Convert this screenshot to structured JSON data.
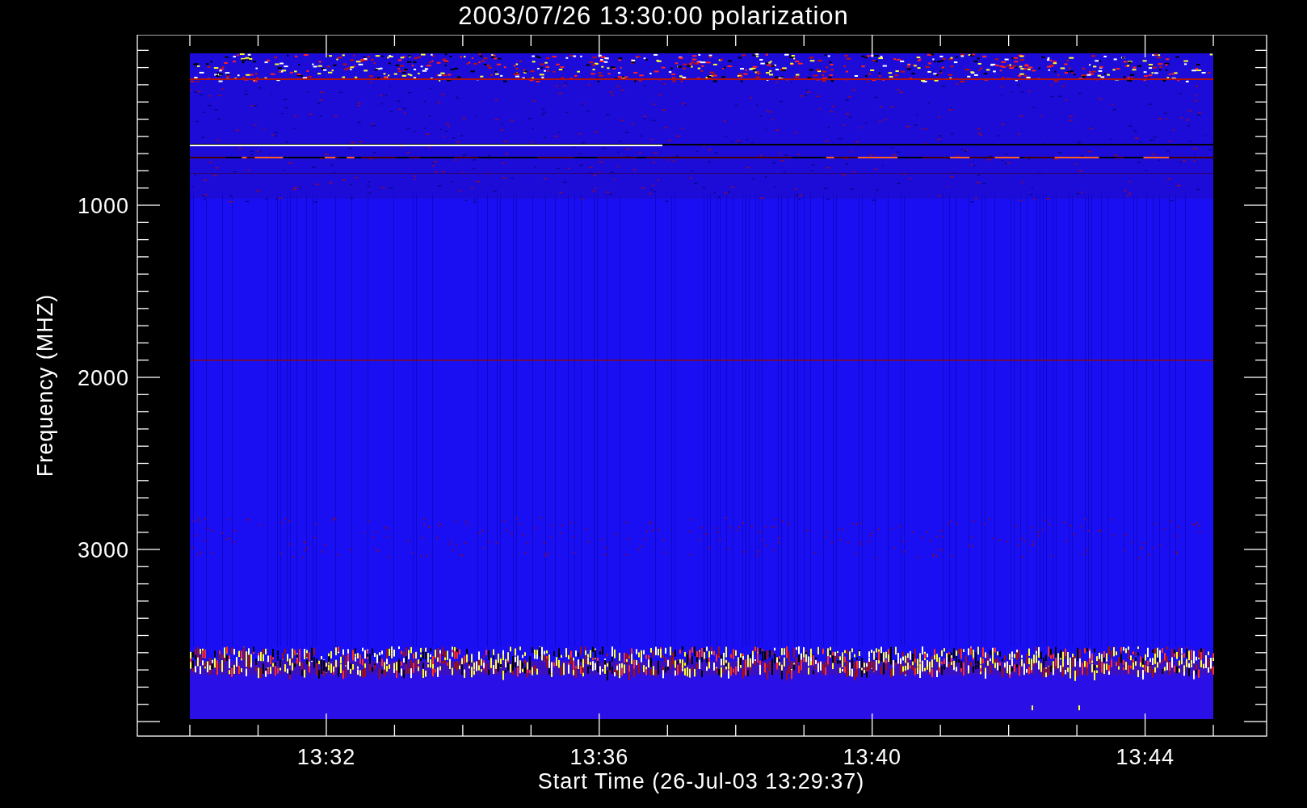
{
  "title": "2003/07/26 13:30:00 polarization",
  "y_axis": {
    "label": "Frequency (MHZ)",
    "ticks": [
      "1000",
      "2000",
      "3000"
    ]
  },
  "x_axis": {
    "label": "Start Time (26-Jul-03 13:29:37)",
    "ticks": [
      "13:32",
      "13:36",
      "13:40",
      "13:44"
    ]
  }
}
